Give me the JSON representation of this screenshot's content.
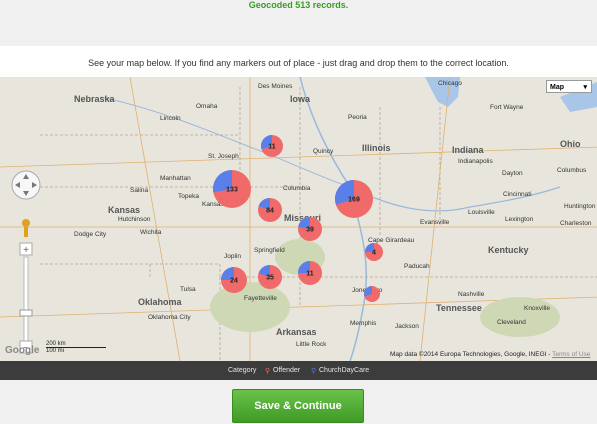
{
  "status": {
    "message": "Geocoded 513 records."
  },
  "instructions": "See your map below. If you find any markers out of place - just drag and drop them to the correct location.",
  "map": {
    "type_control": "Map",
    "copyright": "Map data ©2014 Europa Technologies, Google, INEGI -",
    "terms": "Terms of Use",
    "google_logo": "Google",
    "scale_km": "200 km",
    "scale_mi": "100 mi",
    "states": [
      "Nebraska",
      "Iowa",
      "Illinois",
      "Indiana",
      "Ohio",
      "Kansas",
      "Missouri",
      "Kentucky",
      "Oklahoma",
      "Arkansas",
      "Tennessee"
    ],
    "cities": [
      "Chicago",
      "Des Moines",
      "Lincoln",
      "Omaha",
      "Topeka",
      "Kansas City",
      "St. Joseph",
      "Columbia",
      "Springfield",
      "Indianapolis",
      "Cincinnati",
      "Louisville",
      "Nashville",
      "Memphis",
      "Little Rock",
      "Tulsa",
      "Oklahoma City",
      "Wichita",
      "Joplin",
      "Fayetteville",
      "Dayton",
      "Columbus",
      "Evansville",
      "Cape Girardeau",
      "Paducah",
      "Fort Wayne",
      "Peoria",
      "Quincy",
      "Manhattan",
      "Hutchinson",
      "Dodge City",
      "Salina",
      "Jonesboro",
      "Jackson",
      "Lexington",
      "Huntington",
      "Charleston",
      "Knoxville",
      "Cleveland"
    ],
    "clusters": [
      {
        "label": "11",
        "offender_fraction": 0.7
      },
      {
        "label": "133",
        "offender_fraction": 0.72
      },
      {
        "label": "84",
        "offender_fraction": 0.8
      },
      {
        "label": "169",
        "offender_fraction": 0.7
      },
      {
        "label": "39",
        "offender_fraction": 0.78
      },
      {
        "label": "4",
        "offender_fraction": 0.75
      },
      {
        "label": "24",
        "offender_fraction": 0.75
      },
      {
        "label": "35",
        "offender_fraction": 0.8
      },
      {
        "label": "11",
        "offender_fraction": 0.75
      },
      {
        "label": "",
        "offender_fraction": 0.7
      }
    ]
  },
  "legend": {
    "title": "Category",
    "items": [
      {
        "label": "Offender",
        "color": "#f06a6a"
      },
      {
        "label": "ChurchDayCare",
        "color": "#5b7fe8"
      }
    ]
  },
  "actions": {
    "save_label": "Save & Continue"
  },
  "colors": {
    "accent": "#4aaa2f",
    "offender": "#f06a6a",
    "daycare": "#5b7fe8"
  }
}
